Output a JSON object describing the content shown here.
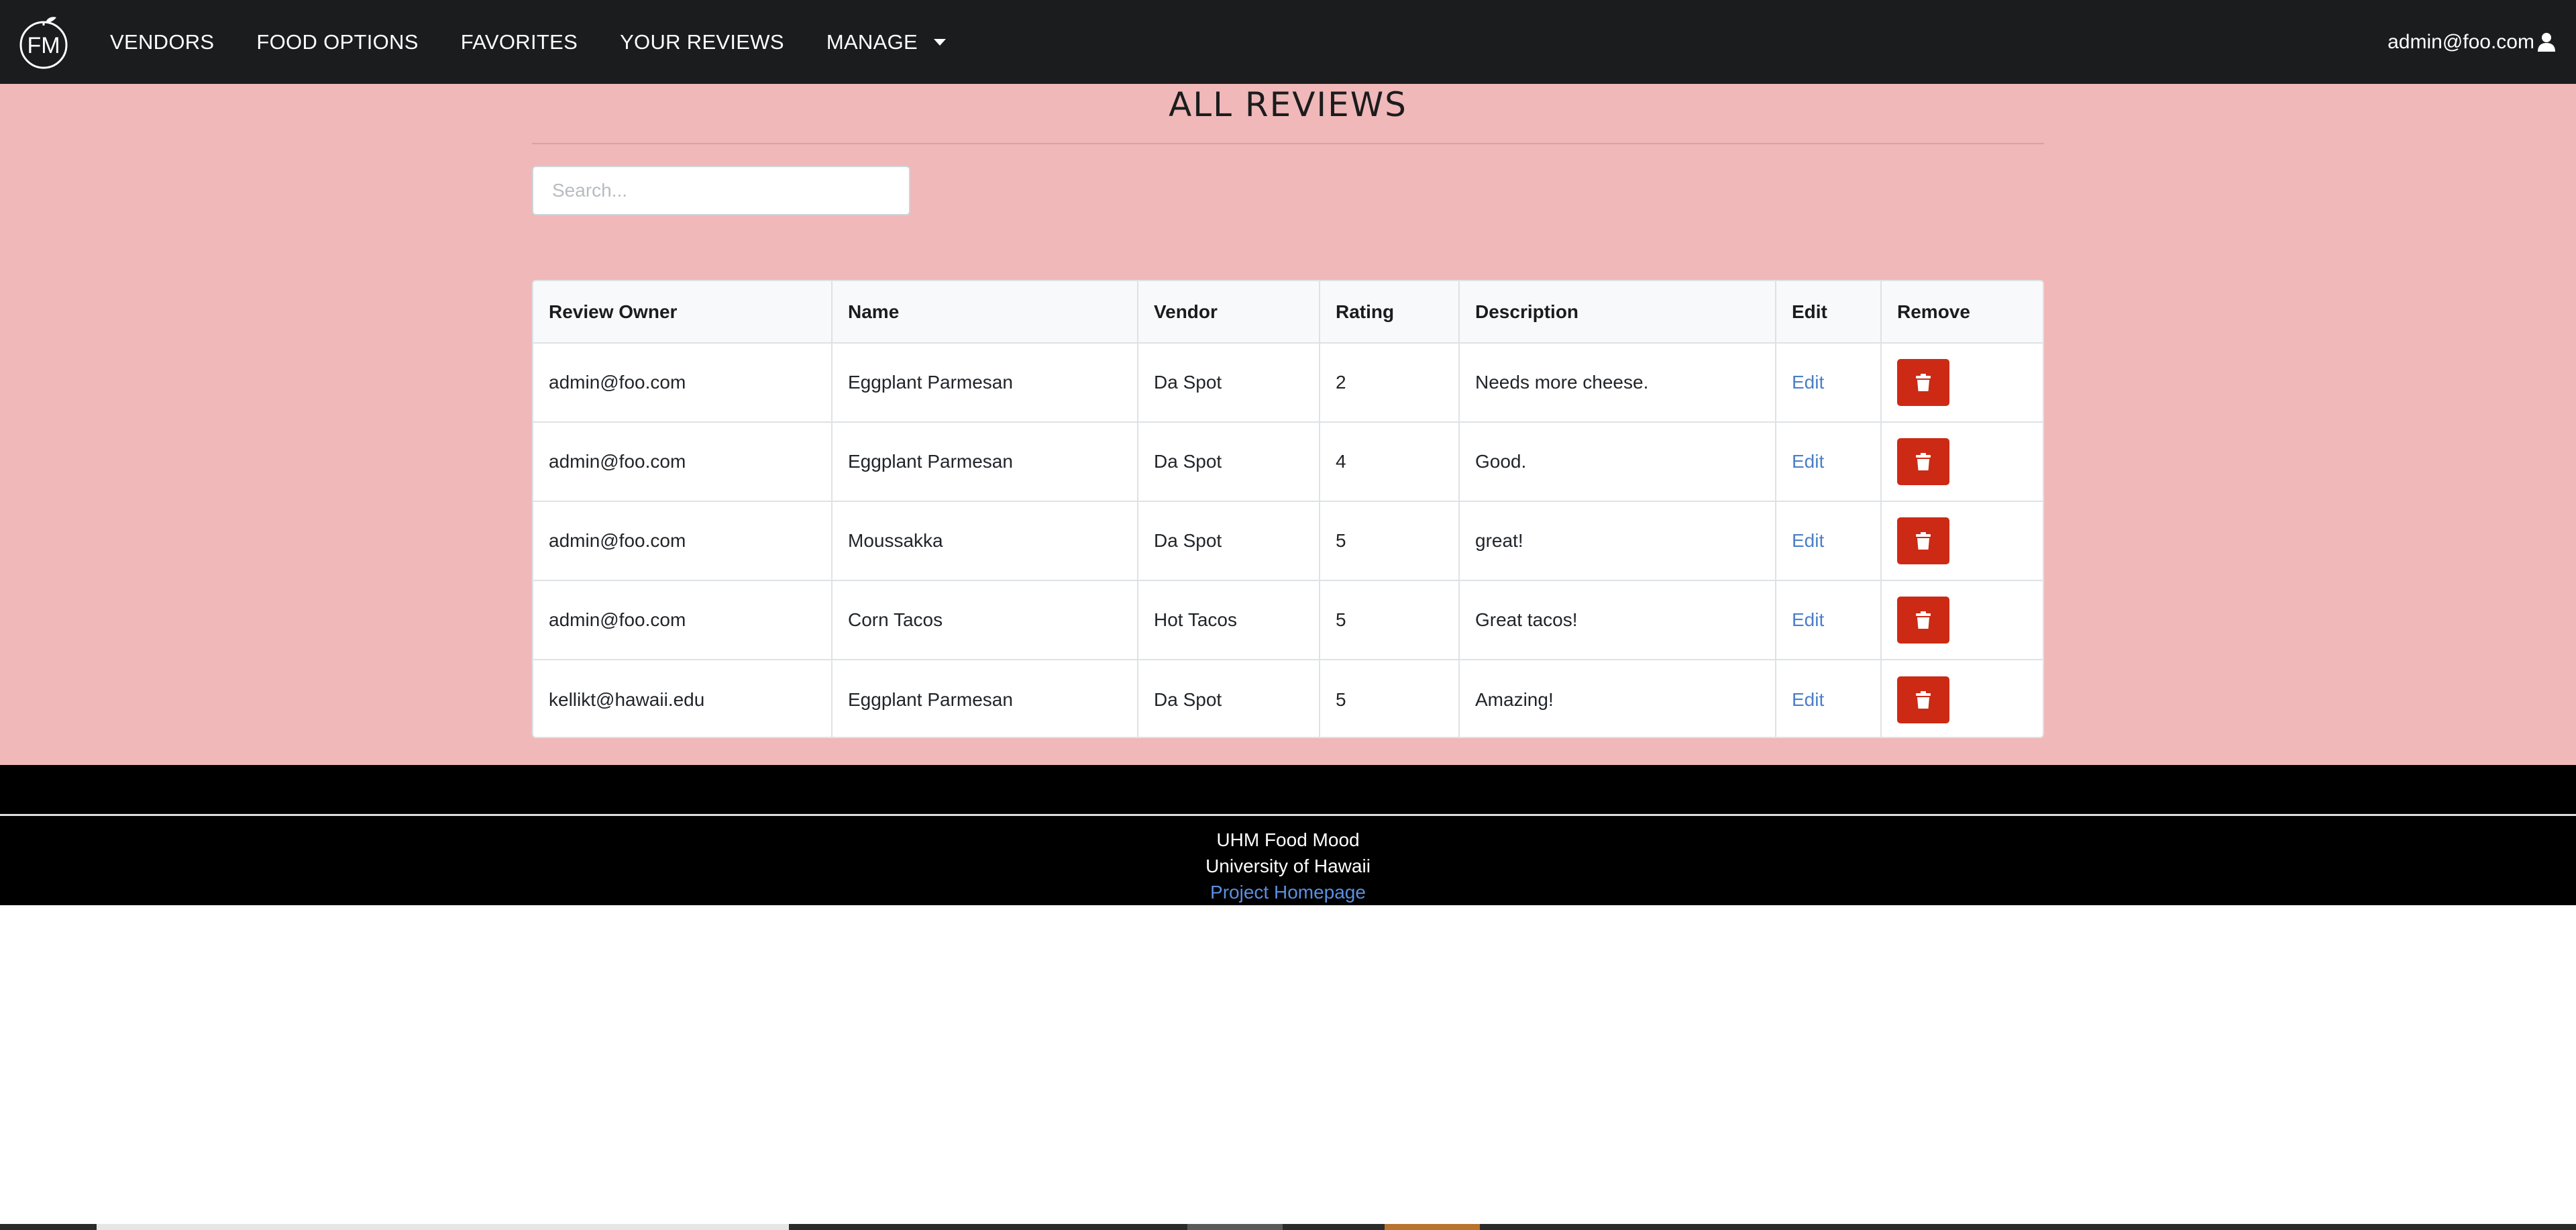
{
  "nav": {
    "logo_text": "FM",
    "items": [
      {
        "label": "VENDORS"
      },
      {
        "label": "FOOD OPTIONS"
      },
      {
        "label": "FAVORITES"
      },
      {
        "label": "YOUR REVIEWS"
      },
      {
        "label": "MANAGE"
      }
    ],
    "user_email": "admin@foo.com",
    "user_icon": "user-icon",
    "manage_icon": "caret-down-icon"
  },
  "main": {
    "title": "ALL REVIEWS",
    "search": {
      "placeholder": "Search...",
      "value": ""
    },
    "table": {
      "headers": [
        "Review Owner",
        "Name",
        "Vendor",
        "Rating",
        "Description",
        "Edit",
        "Remove"
      ],
      "rows": [
        {
          "owner": "admin@foo.com",
          "name": "Eggplant Parmesan",
          "vendor": "Da Spot",
          "rating": "2",
          "description": "Needs more cheese.",
          "edit": "Edit"
        },
        {
          "owner": "admin@foo.com",
          "name": "Eggplant Parmesan",
          "vendor": "Da Spot",
          "rating": "4",
          "description": "Good.",
          "edit": "Edit"
        },
        {
          "owner": "admin@foo.com",
          "name": "Moussakka",
          "vendor": "Da Spot",
          "rating": "5",
          "description": "great!",
          "edit": "Edit"
        },
        {
          "owner": "admin@foo.com",
          "name": "Corn Tacos",
          "vendor": "Hot Tacos",
          "rating": "5",
          "description": "Great tacos!",
          "edit": "Edit"
        },
        {
          "owner": "kellikt@hawaii.edu",
          "name": "Eggplant Parmesan",
          "vendor": "Da Spot",
          "rating": "5",
          "description": "Amazing!",
          "edit": "Edit"
        }
      ],
      "remove_icon": "trash-icon"
    }
  },
  "footer": {
    "line1": "UHM Food Mood",
    "line2": "University of Hawaii",
    "link": "Project Homepage"
  },
  "colors": {
    "navbar": "#1b1c1d",
    "page_background": "#f0b8b8",
    "remove_button": "#cc2a14",
    "link": "#4a7fc8",
    "footer": "#000000"
  }
}
